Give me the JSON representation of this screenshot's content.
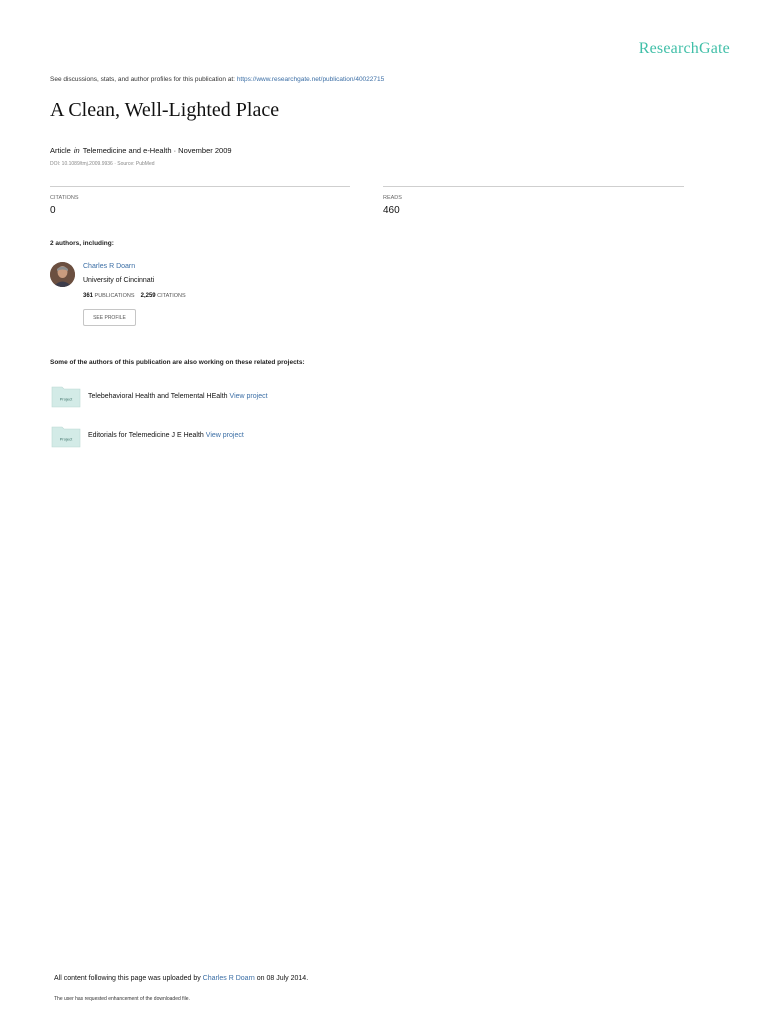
{
  "brand": "ResearchGate",
  "header": {
    "discuss_text": "See discussions, stats, and author profiles for this publication at:",
    "publication_url": "https://www.researchgate.net/publication/40022715"
  },
  "article": {
    "title": "A Clean, Well-Lighted Place",
    "type": "Article",
    "in_label": "in",
    "journal": "Telemedicine and e-Health",
    "date": "· November 2009",
    "doi_line": "DOI: 10.1089/tmj.2009.9936 · Source: PubMed"
  },
  "stats": {
    "citations_label": "CITATIONS",
    "citations_value": "0",
    "reads_label": "READS",
    "reads_value": "460"
  },
  "authors": {
    "heading": "2 authors, including:",
    "list": [
      {
        "name": "Charles R Doarn",
        "institution": "University of Cincinnati",
        "publications_count": "361",
        "publications_label": "PUBLICATIONS",
        "citations_count": "2,259",
        "citations_label": "CITATIONS",
        "button_label": "SEE PROFILE"
      }
    ]
  },
  "projects": {
    "heading": "Some of the authors of this publication are also working on these related projects:",
    "icon_label": "Project",
    "view_label": "View project",
    "items": [
      {
        "title": "Telebehavioral Health and Telemental HEalth"
      },
      {
        "title": "Editorials for Telemedicine J E Health"
      }
    ]
  },
  "footer": {
    "uploaded_prefix": "All content following this page was uploaded by",
    "uploader": "Charles R Doarn",
    "uploaded_date": "on 08 July 2014.",
    "enhancement_note": "The user has requested enhancement of the downloaded file."
  },
  "colors": {
    "brand": "#40bfa8",
    "link": "#3b6ea5",
    "project_icon": "#d3ebe7"
  }
}
